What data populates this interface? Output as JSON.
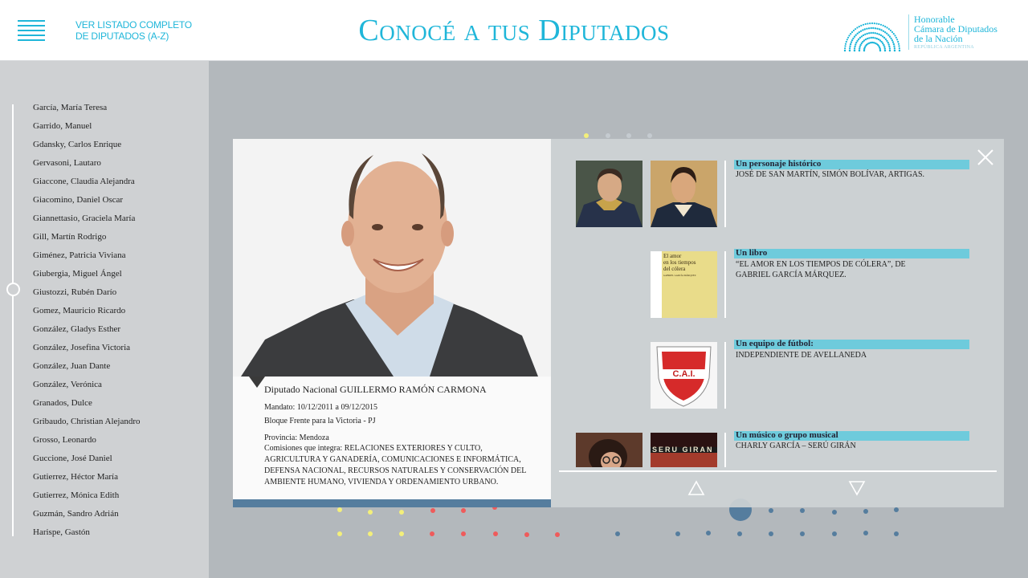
{
  "header": {
    "menu_icon": "hamburger-menu-icon",
    "listado_line1": "VER LISTADO COMPLETO",
    "listado_line2": "DE DIPUTADOS (A-Z)",
    "title": "Conocé a tus Diputados",
    "logo_line1": "Honorable",
    "logo_line2": "Cámara de Diputados",
    "logo_line3": "de la Nación",
    "logo_line4": "REPÚBLICA ARGENTINA"
  },
  "colors": {
    "accent": "#1fb6d9",
    "label_bg": "#6ecbdc",
    "card_bar": "#557d9e",
    "background": "#b3b8bc",
    "sidebar": "#cfd1d3"
  },
  "sidebar": {
    "items": [
      "García, María Teresa",
      "Garrido, Manuel",
      "Gdansky, Carlos Enrique",
      "Gervasoni, Lautaro",
      "Giaccone, Claudia Alejandra",
      "Giacomino, Daniel Oscar",
      "Giannettasio, Graciela María",
      "Gill, Martín Rodrigo",
      "Giménez, Patricia Viviana",
      "Giubergia, Miguel Ángel",
      "Giustozzi, Rubén Darío",
      "Gomez, Mauricio Ricardo",
      "González, Gladys Esther",
      "González, Josefina Victoria",
      "González, Juan Dante",
      "González, Verónica",
      "Granados, Dulce",
      "Gribaudo, Christian Alejandro",
      "Grosso, Leonardo",
      "Guccione, José Daniel",
      "Gutierrez, Héctor María",
      "Gutierrez, Mónica Edith",
      "Guzmán, Sandro Adrián",
      "Harispe, Gastón"
    ]
  },
  "profile": {
    "name": "Diputado Nacional GUILLERMO RAMÓN CARMONA",
    "mandato": "Mandato: 10/12/2011 a 09/12/2015",
    "bloque": "Bloque Frente para la Victoria - PJ",
    "provincia": "Provincia: Mendoza",
    "comisiones": "Comisiones que integra: RELACIONES EXTERIORES Y CULTO, AGRICULTURA Y GANADERÍA, COMUNICACIONES E INFORMÁTICA, DEFENSA NACIONAL, RECURSOS NATURALES Y CONSERVACIÓN DEL AMBIENTE HUMANO, VIVIENDA Y ORDENAMIENTO URBANO."
  },
  "favorites": [
    {
      "label": "Un personaje histórico",
      "value": "JOSÉ DE SAN MARTÍN, SIMÓN BOLÍVAR, ARTIGAS."
    },
    {
      "label": "Un libro",
      "value": "“EL AMOR EN LOS TIEMPOS DE CÓLERA”, DE GABRIEL GARCÍA MÁRQUEZ."
    },
    {
      "label": "Un equipo de fútbol:",
      "value": "INDEPENDIENTE DE AVELLANEDA"
    },
    {
      "label": "Un músico o grupo musical",
      "value": "CHARLY GARCÍA – SERÚ GIRÁN"
    }
  ],
  "book_cover": {
    "line1": "El amor",
    "line2": "en los tiempos",
    "line3": "del cólera",
    "author": "GABRIEL GARCÍA MÁRQUEZ"
  },
  "team_crest": {
    "text": "C.A.I."
  },
  "album_text": "SERU GIRAN",
  "icons": {
    "close": "close-icon",
    "up": "triangle-up-icon",
    "down": "triangle-down-icon"
  }
}
